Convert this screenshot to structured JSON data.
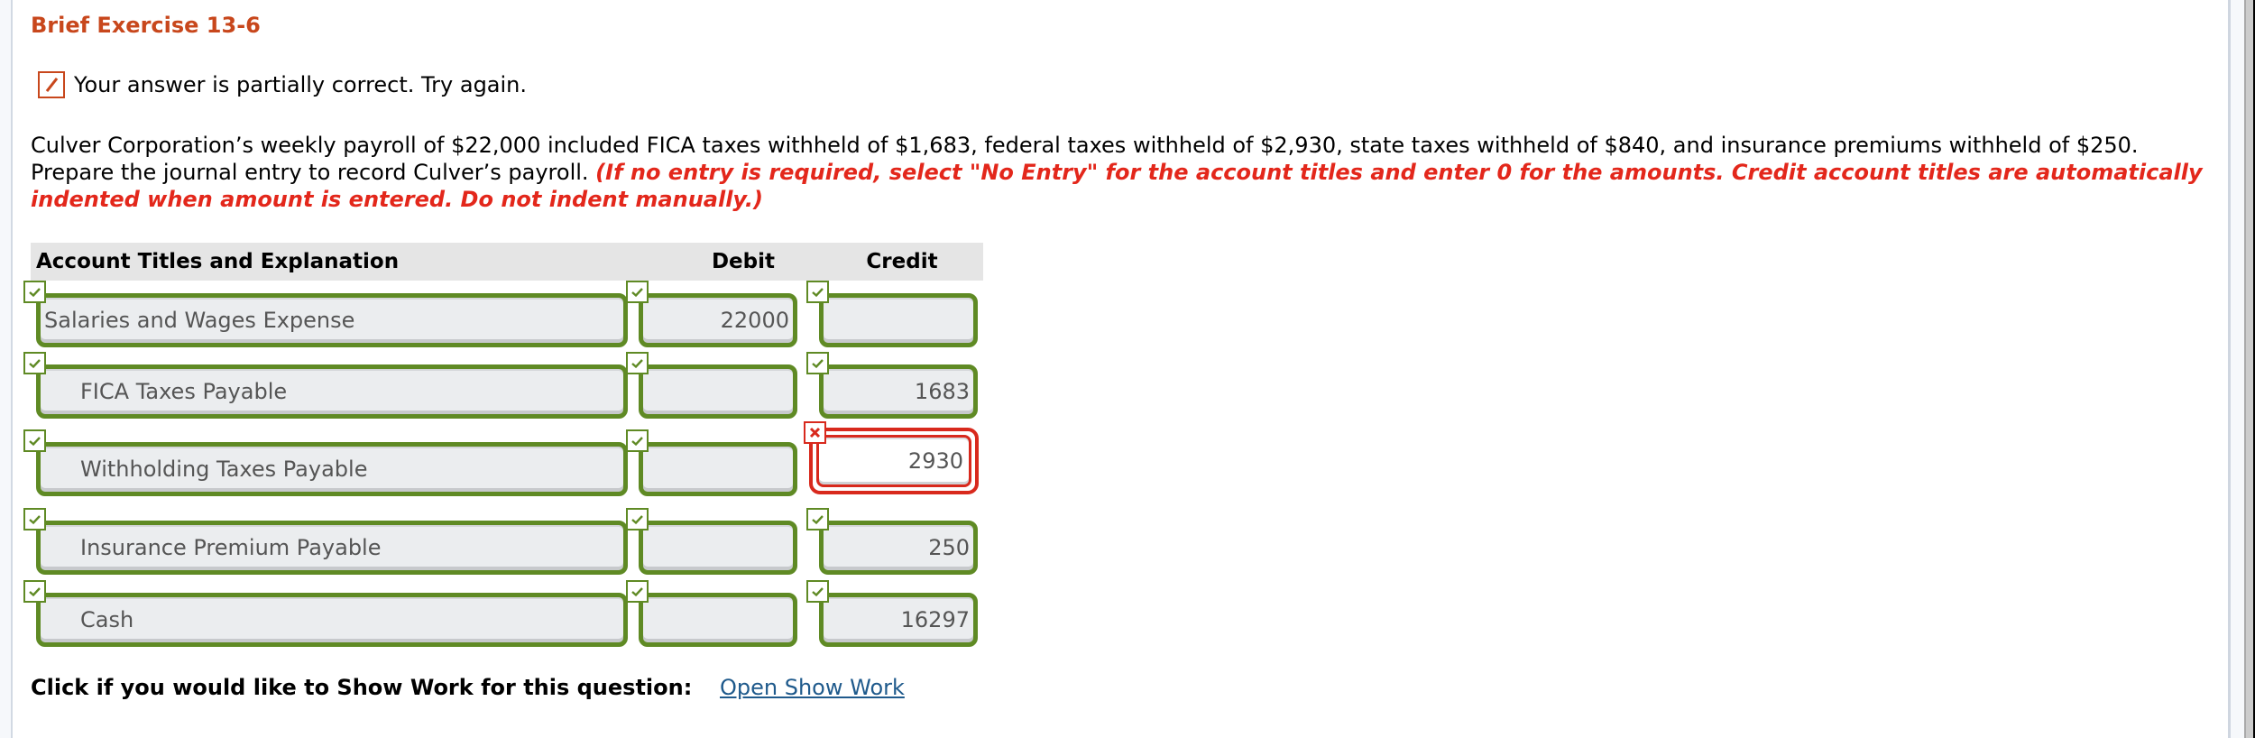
{
  "exercise": {
    "title": "Brief Exercise 13-6"
  },
  "feedback": {
    "status": "partially-correct",
    "icon": "partially-correct-icon",
    "message": "Your answer is partially correct.  Try again."
  },
  "question": {
    "text": "Culver Corporation’s weekly payroll of $22,000 included FICA taxes withheld of $1,683, federal taxes withheld of $2,930, state taxes withheld of $840, and insurance premiums withheld of $250. Prepare the journal entry to record Culver’s payroll. ",
    "instructions": "(If no entry is required, select \"No Entry\" for the account titles and enter 0 for the amounts. Credit account titles are automatically indented when amount is entered. Do not indent manually.)"
  },
  "journal": {
    "headers": {
      "account": "Account Titles and Explanation",
      "debit": "Debit",
      "credit": "Credit"
    },
    "rows": [
      {
        "account": "Salaries and Wages Expense",
        "debit": "22000",
        "credit": "",
        "account_status": "correct",
        "debit_status": "correct",
        "credit_status": "correct",
        "indented": false
      },
      {
        "account": "FICA Taxes Payable",
        "debit": "",
        "credit": "1683",
        "account_status": "correct",
        "debit_status": "correct",
        "credit_status": "correct",
        "indented": true
      },
      {
        "account": "Withholding Taxes Payable",
        "debit": "",
        "credit": "2930",
        "account_status": "correct",
        "debit_status": "correct",
        "credit_status": "incorrect",
        "indented": true
      },
      {
        "account": "Insurance Premium Payable",
        "debit": "",
        "credit": "250",
        "account_status": "correct",
        "debit_status": "correct",
        "credit_status": "correct",
        "indented": true
      },
      {
        "account": "Cash",
        "debit": "",
        "credit": "16297",
        "account_status": "correct",
        "debit_status": "correct",
        "credit_status": "correct",
        "indented": true
      }
    ]
  },
  "show_work": {
    "prompt": "Click if you would like to Show Work for this question:",
    "link_label": "Open Show Work"
  },
  "colors": {
    "title": "#c8471c",
    "instructions": "#e3271b",
    "correct": "#5f8a24",
    "incorrect": "#d8291d",
    "link": "#1f5a8c"
  }
}
